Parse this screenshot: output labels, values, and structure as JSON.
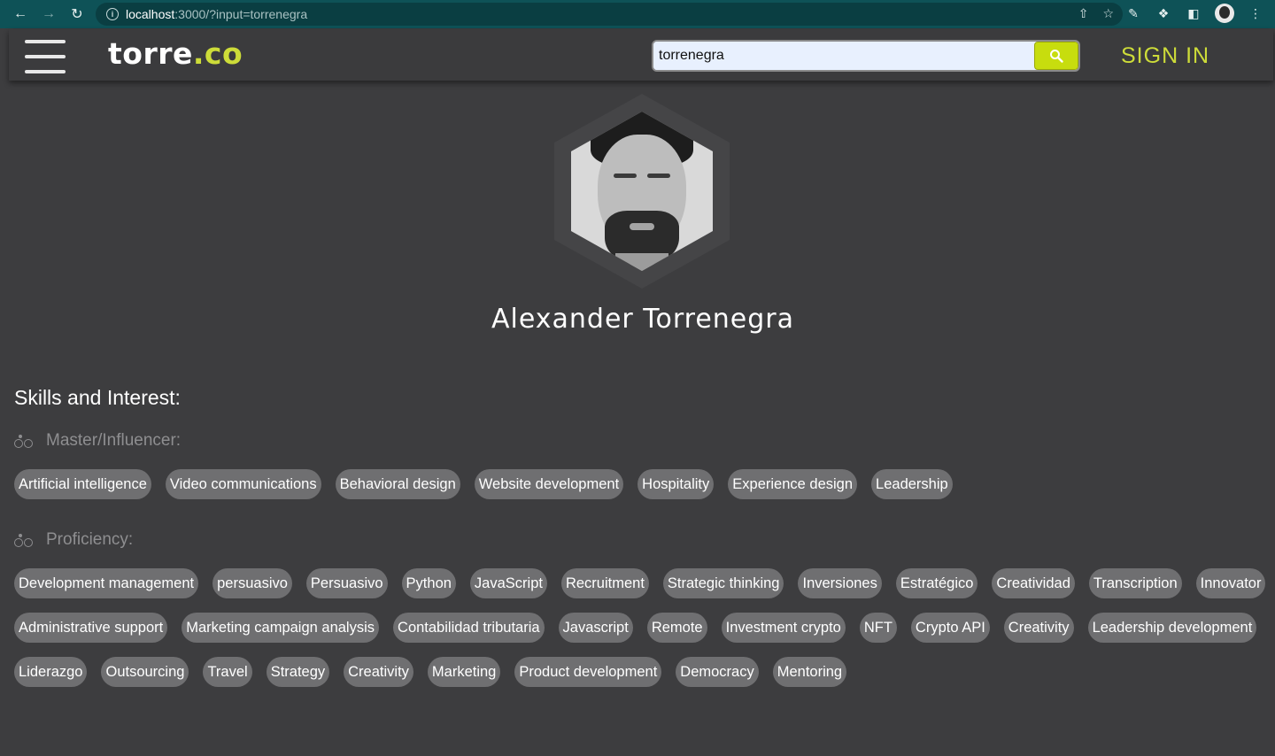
{
  "browser": {
    "url_host": "localhost",
    "url_path": ":3000/?input=torrenegra"
  },
  "header": {
    "logo_main": "torre",
    "logo_suffix": ".co",
    "search_value": "torrenegra",
    "signin_label": "SIGN IN"
  },
  "profile": {
    "name": "Alexander Torrenegra"
  },
  "skills": {
    "title": "Skills and Interest:",
    "master_label": "Master/Influencer:",
    "master": [
      "Artificial intelligence",
      "Video communications",
      "Behavioral design",
      "Website development",
      "Hospitality",
      "Experience design",
      "Leadership"
    ],
    "proficiency_label": "Proficiency:",
    "proficiency_row1": [
      "Development management",
      "persuasivo",
      "Persuasivo",
      "Python",
      "JavaScript",
      "Recruitment",
      "Strategic thinking",
      "Inversiones",
      "Estratégico",
      "Creatividad",
      "Transcription",
      "Innovator"
    ],
    "proficiency_row2": [
      "Administrative support",
      "Marketing campaign analysis",
      "Contabilidad tributaria",
      "Javascript",
      "Remote",
      "Investment crypto",
      "NFT",
      "Crypto API",
      "Creativity",
      "Leadership development"
    ],
    "proficiency_row3": [
      "Liderazgo",
      "Outsourcing",
      "Travel",
      "Strategy",
      "Creativity",
      "Marketing",
      "Product development",
      "Democracy",
      "Mentoring"
    ]
  }
}
